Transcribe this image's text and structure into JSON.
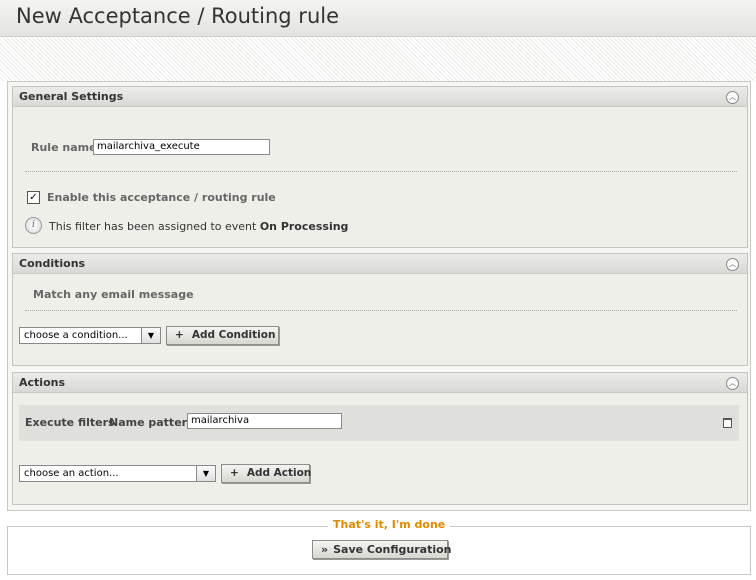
{
  "page": {
    "title": "New Acceptance / Routing rule"
  },
  "general": {
    "title": "General Settings",
    "rule_name_label": "Rule name",
    "rule_name_value": "mailarchiva_execute",
    "enable_label": "Enable this acceptance / routing rule",
    "enable_checked": true,
    "info_text": "This filter has been assigned to event ",
    "info_event": "On Processing"
  },
  "conditions": {
    "title": "Conditions",
    "match_text": "Match any email message",
    "select_value": "choose a condition...",
    "add_button": "Add Condition"
  },
  "actions": {
    "title": "Actions",
    "row_label": "Execute filters",
    "pattern_label": "Name pattern",
    "pattern_value": "mailarchiva",
    "select_value": "choose an action...",
    "add_button": "Add Action"
  },
  "footer": {
    "legend": "That's it, I'm done",
    "save_button": "Save Configuration"
  },
  "icons": {
    "collapse": "collapse-icon",
    "info": "info-icon",
    "trash": "trash-icon",
    "plus": "plus-icon",
    "chevrons": "double-chevron-icon"
  }
}
